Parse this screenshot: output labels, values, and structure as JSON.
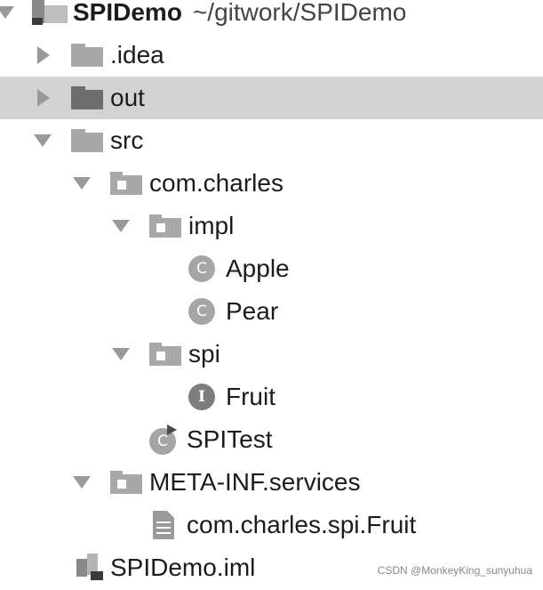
{
  "tree": {
    "root": {
      "label": "SPIDemo",
      "path": "~/gitwork/SPIDemo",
      "icon": "module-folder-icon"
    },
    "idea": {
      "label": ".idea",
      "icon": "folder-icon"
    },
    "out": {
      "label": "out",
      "icon": "folder-icon"
    },
    "src": {
      "label": "src",
      "icon": "source-folder-icon"
    },
    "pkg_charles": {
      "label": "com.charles",
      "icon": "package-icon"
    },
    "pkg_impl": {
      "label": "impl",
      "icon": "package-icon"
    },
    "apple": {
      "label": "Apple",
      "badge": "C",
      "icon": "class-icon"
    },
    "pear": {
      "label": "Pear",
      "badge": "C",
      "icon": "class-icon"
    },
    "pkg_spi": {
      "label": "spi",
      "icon": "package-icon"
    },
    "fruit": {
      "label": "Fruit",
      "badge": "I",
      "icon": "interface-icon"
    },
    "spitest": {
      "label": "SPITest",
      "badge": "C",
      "icon": "runnable-class-icon"
    },
    "meta_inf": {
      "label": "META-INF.services",
      "icon": "package-icon"
    },
    "services_file": {
      "label": "com.charles.spi.Fruit",
      "icon": "text-file-icon"
    },
    "iml": {
      "label": "SPIDemo.iml",
      "icon": "iml-file-icon"
    }
  },
  "watermark": "CSDN @MonkeyKing_sunyuhua",
  "colors": {
    "selection": "#d3d3d3",
    "icon_gray": "#8f8f8f"
  }
}
